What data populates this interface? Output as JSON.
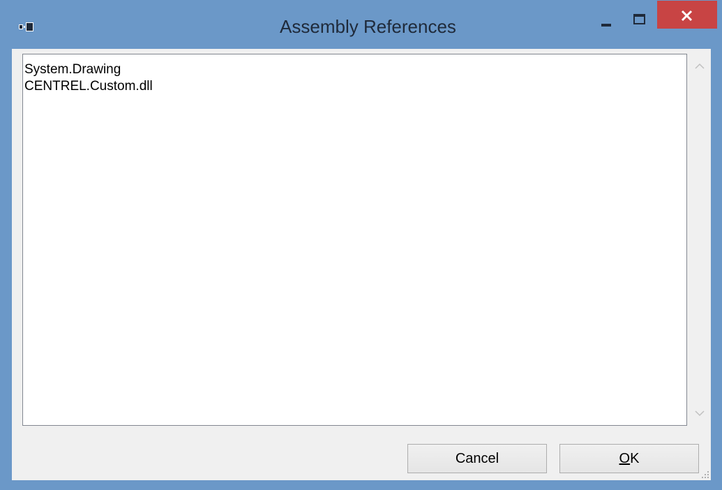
{
  "window": {
    "title": "Assembly References",
    "icons": {
      "app": "app-window-icon",
      "minimize": "minimize-icon",
      "maximize": "maximize-icon",
      "close": "close-icon"
    },
    "colors": {
      "frame": "#6b98c8",
      "close": "#c84444",
      "client": "#f0f0f0"
    }
  },
  "textbox": {
    "lines": [
      "System.Drawing",
      "CENTREL.Custom.dll"
    ],
    "scrollbar": {
      "up_icon": "chevron-up-icon",
      "down_icon": "chevron-down-icon"
    }
  },
  "buttons": {
    "cancel_label": "Cancel",
    "ok_first": "O",
    "ok_rest": "K"
  }
}
